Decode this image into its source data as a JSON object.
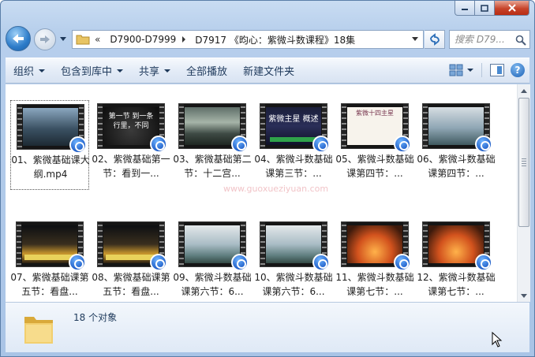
{
  "window": {
    "address": {
      "overflow": "«",
      "crumbs": [
        "D7900-D7999",
        "D7917 《昀心：紫微斗数课程》18集"
      ]
    },
    "search": {
      "placeholder": "搜索 D79..."
    }
  },
  "toolbar": {
    "organize": "组织",
    "include_library": "包含到库中",
    "share": "共享",
    "play_all": "全部播放",
    "new_folder": "新建文件夹"
  },
  "files": [
    {
      "name": "01、紫微基础课大纲.mp4",
      "thumb": "sky",
      "caption": ""
    },
    {
      "name": "02、紫微基础第一节：看到一...",
      "thumb": "dark",
      "caption": "第一节 到一条行里，不同"
    },
    {
      "name": "03、紫微基础第二节：十二宫...",
      "thumb": "city",
      "caption": ""
    },
    {
      "name": "04、紫微斗数基础课第三节：...",
      "thumb": "star",
      "caption": "紫微主星 概述"
    },
    {
      "name": "05、紫微斗数基础课第四节：...",
      "thumb": "icons",
      "caption": "紫微十四主星"
    },
    {
      "name": "06、紫微斗数基础课第四节：...",
      "thumb": "ink",
      "caption": ""
    },
    {
      "name": "07、紫微基础课第五节：看盘...",
      "thumb": "palace",
      "caption": ""
    },
    {
      "name": "08、紫微基础课第五节：看盘...",
      "thumb": "palace",
      "caption": ""
    },
    {
      "name": "09、紫微斗数基础课第六节：6...",
      "thumb": "ink2",
      "caption": ""
    },
    {
      "name": "10、紫微斗数基础课第六节：6...",
      "thumb": "ink2",
      "caption": ""
    },
    {
      "name": "11、紫微斗数基础课第七节：...",
      "thumb": "fire",
      "caption": ""
    },
    {
      "name": "12、紫微斗数基础课第七节：...",
      "thumb": "fire",
      "caption": ""
    }
  ],
  "status": {
    "count": "18 个对象"
  },
  "watermark": {
    "site": "www.guoxueziyuan.com"
  },
  "colors": {
    "accent": "#1e395b",
    "selection_border": "#555555"
  }
}
